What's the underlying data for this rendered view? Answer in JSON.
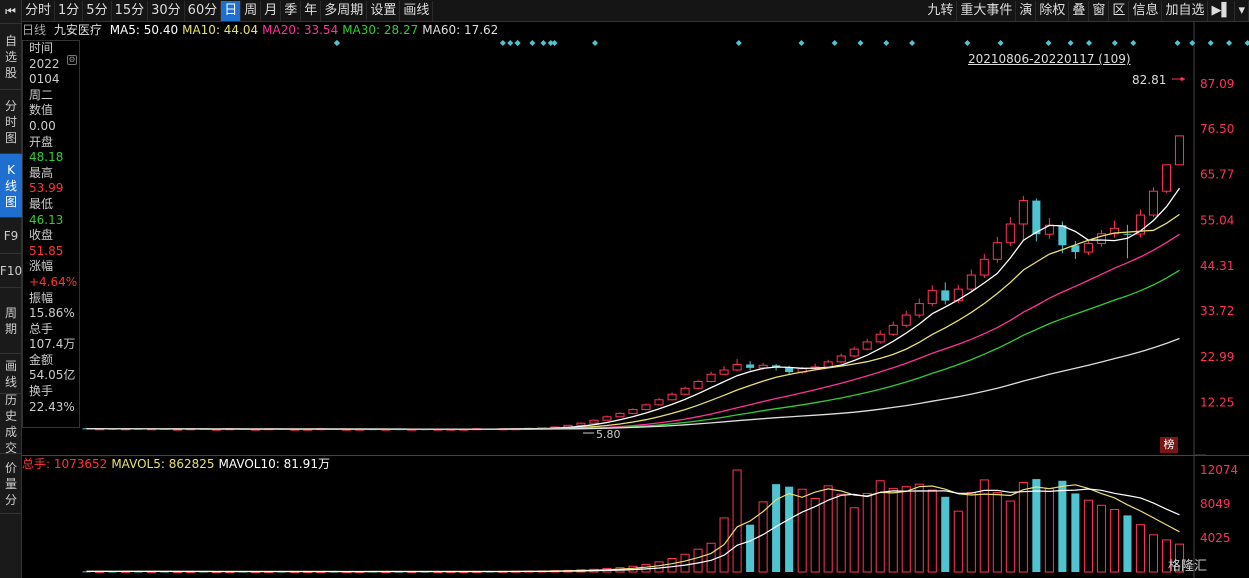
{
  "left_nav": {
    "home_icon": "first-page-icon",
    "items": [
      {
        "label": "自\n选\n股",
        "active": false
      },
      {
        "label": "分\n时\n图",
        "active": false
      },
      {
        "label": "K\n线\n图",
        "active": true
      },
      {
        "label": "F9",
        "active": false
      },
      {
        "label": "F10",
        "active": false
      },
      {
        "label": "周\n期",
        "active": false
      },
      {
        "label": "画\n线",
        "active": false
      },
      {
        "label": "历\n史\n成\n交",
        "active": false
      },
      {
        "label": "价\n量\n分",
        "active": false
      }
    ]
  },
  "toolbar": {
    "periods": [
      "分时",
      "1分",
      "5分",
      "15分",
      "30分",
      "60分",
      "日",
      "周",
      "月",
      "季",
      "年",
      "多周期",
      "设置",
      "画线"
    ],
    "active_period": "日",
    "right_items": [
      "九转",
      "重大事件",
      "演",
      "除权",
      "叠",
      "窗",
      "区",
      "信息",
      "加自选",
      "▶︎▌",
      "▾"
    ]
  },
  "ma_legend": {
    "period_label": "日线",
    "stock_name": "九安医疗",
    "items": [
      {
        "label": "MA5: 50.40",
        "color": "#ffffff"
      },
      {
        "label": "MA10: 44.04",
        "color": "#e8e070"
      },
      {
        "label": "MA20: 33.54",
        "color": "#ff3399"
      },
      {
        "label": "MA30: 28.27",
        "color": "#33cc33"
      },
      {
        "label": "MA60: 17.62",
        "color": "#dddddd"
      }
    ]
  },
  "info_panel": {
    "rows": [
      {
        "label": "时间",
        "value": "2022",
        "color": "#ccc"
      },
      {
        "label": "",
        "value": "0104",
        "color": "#ccc"
      },
      {
        "label": "",
        "value": "周二",
        "color": "#ccc"
      },
      {
        "label": "数值",
        "value": "0.00",
        "color": "#ccc"
      },
      {
        "label": "开盘",
        "value": "48.18",
        "color": "#33cc33"
      },
      {
        "label": "最高",
        "value": "53.99",
        "color": "#ff3333"
      },
      {
        "label": "最低",
        "value": "46.13",
        "color": "#33cc33"
      },
      {
        "label": "收盘",
        "value": "51.85",
        "color": "#ff3333"
      },
      {
        "label": "涨幅",
        "value": "+4.64%",
        "color": "#ff3333"
      },
      {
        "label": "振幅",
        "value": "15.86%",
        "color": "#ccc"
      },
      {
        "label": "总手",
        "value": "107.4万",
        "color": "#ccc"
      },
      {
        "label": "金额",
        "value": "54.05亿",
        "color": "#ccc"
      },
      {
        "label": "换手",
        "value": "22.43%",
        "color": "#ccc"
      }
    ]
  },
  "chart_annotations": {
    "range_label": "20210806-20220117 (109)",
    "last_price_label": "82.81",
    "min_price_label": "5.80",
    "badge": "榜"
  },
  "volume_legend": {
    "items": [
      {
        "label": "总手: 1073652",
        "color": "#ff3333"
      },
      {
        "label": "MAVOL5: 862825",
        "color": "#e8e070"
      },
      {
        "label": "MAVOL10: 81.91万",
        "color": "#ffffff"
      }
    ]
  },
  "watermark": "格隆汇",
  "colors": {
    "up": "#ff3355",
    "down": "#4fc3d0",
    "signal": "#4fc3d0"
  },
  "chart_data": {
    "type": "candlestick",
    "price_axis": {
      "ticks": [
        87.09,
        76.5,
        65.77,
        55.04,
        44.31,
        33.72,
        22.99,
        12.25
      ],
      "range": [
        5.8,
        87.09
      ]
    },
    "volume_axis": {
      "ticks": [
        12074,
        8049,
        4025
      ],
      "range": [
        0,
        12074
      ]
    },
    "candles": [
      [
        6.2,
        6.1,
        6.3,
        6.0
      ],
      [
        6.1,
        6.1,
        6.2,
        6.0
      ],
      [
        6.1,
        6.0,
        6.2,
        5.9
      ],
      [
        6.0,
        6.1,
        6.2,
        5.9
      ],
      [
        6.1,
        6.0,
        6.1,
        5.9
      ],
      [
        6.0,
        6.1,
        6.2,
        5.9
      ],
      [
        6.1,
        6.0,
        6.2,
        5.9
      ],
      [
        6.0,
        6.0,
        6.1,
        5.9
      ],
      [
        6.0,
        6.1,
        6.2,
        5.9
      ],
      [
        6.1,
        6.0,
        6.2,
        5.9
      ],
      [
        6.0,
        6.0,
        6.1,
        5.9
      ],
      [
        6.0,
        6.1,
        6.1,
        5.9
      ],
      [
        6.1,
        6.0,
        6.2,
        5.9
      ],
      [
        6.0,
        6.0,
        6.1,
        5.9
      ],
      [
        6.0,
        6.1,
        6.1,
        5.9
      ],
      [
        6.1,
        6.0,
        6.2,
        5.9
      ],
      [
        6.0,
        6.0,
        6.1,
        5.9
      ],
      [
        6.0,
        6.0,
        6.1,
        5.9
      ],
      [
        6.0,
        6.1,
        6.1,
        5.9
      ],
      [
        6.1,
        6.0,
        6.1,
        5.9
      ],
      [
        6.0,
        6.0,
        6.1,
        5.9
      ],
      [
        6.0,
        6.0,
        6.1,
        5.9
      ],
      [
        6.0,
        5.9,
        6.1,
        5.8
      ],
      [
        5.9,
        6.0,
        6.1,
        5.8
      ],
      [
        6.0,
        5.9,
        6.0,
        5.8
      ],
      [
        5.9,
        6.0,
        6.1,
        5.8
      ],
      [
        6.0,
        5.9,
        6.0,
        5.8
      ],
      [
        5.9,
        6.0,
        6.1,
        5.8
      ],
      [
        6.0,
        6.0,
        6.1,
        5.9
      ],
      [
        6.0,
        6.0,
        6.1,
        5.9
      ],
      [
        6.0,
        6.1,
        6.2,
        5.9
      ],
      [
        6.1,
        6.0,
        6.2,
        5.9
      ],
      [
        6.0,
        6.1,
        6.2,
        5.9
      ],
      [
        6.1,
        6.1,
        6.2,
        6.0
      ],
      [
        6.1,
        6.2,
        6.3,
        6.0
      ],
      [
        6.2,
        6.3,
        6.4,
        6.1
      ],
      [
        6.3,
        6.5,
        6.6,
        6.2
      ],
      [
        6.5,
        6.9,
        7.0,
        6.4
      ],
      [
        6.9,
        7.4,
        7.6,
        6.8
      ],
      [
        7.4,
        8.1,
        8.3,
        7.3
      ],
      [
        8.1,
        8.9,
        9.2,
        8.0
      ],
      [
        8.9,
        9.7,
        10.0,
        8.8
      ],
      [
        9.7,
        10.6,
        10.9,
        9.5
      ],
      [
        10.6,
        11.7,
        12.0,
        10.4
      ],
      [
        11.7,
        12.9,
        13.3,
        11.5
      ],
      [
        12.9,
        14.2,
        14.6,
        12.7
      ],
      [
        14.2,
        15.6,
        16.0,
        14.0
      ],
      [
        15.6,
        17.2,
        17.6,
        15.4
      ],
      [
        17.2,
        18.9,
        19.5,
        17.0
      ],
      [
        18.9,
        19.9,
        20.8,
        18.7
      ],
      [
        19.9,
        21.2,
        22.5,
        19.6
      ],
      [
        21.2,
        20.4,
        22.0,
        19.8
      ],
      [
        20.4,
        21.0,
        21.6,
        19.9
      ],
      [
        21.0,
        20.5,
        21.3,
        19.8
      ],
      [
        20.5,
        19.4,
        20.9,
        18.9
      ],
      [
        19.4,
        20.2,
        20.6,
        19.0
      ],
      [
        20.2,
        20.6,
        21.4,
        19.9
      ],
      [
        20.6,
        21.8,
        22.3,
        20.3
      ],
      [
        21.8,
        23.2,
        23.8,
        21.5
      ],
      [
        23.2,
        24.8,
        25.4,
        22.9
      ],
      [
        24.8,
        26.5,
        27.2,
        24.5
      ],
      [
        26.5,
        28.3,
        29.2,
        26.1
      ],
      [
        28.3,
        30.4,
        31.3,
        27.9
      ],
      [
        30.4,
        32.8,
        33.8,
        29.9
      ],
      [
        32.8,
        35.5,
        36.7,
        32.2
      ],
      [
        35.5,
        38.6,
        39.8,
        34.9
      ],
      [
        38.6,
        36.2,
        40.5,
        35.3
      ],
      [
        36.2,
        38.9,
        39.9,
        35.6
      ],
      [
        38.9,
        42.2,
        43.5,
        38.2
      ],
      [
        42.2,
        45.9,
        47.2,
        41.5
      ],
      [
        45.9,
        49.8,
        51.2,
        45.1
      ],
      [
        49.8,
        54.2,
        55.8,
        49.0
      ],
      [
        54.2,
        59.7,
        60.8,
        50.3
      ],
      [
        59.7,
        51.8,
        60.2,
        50.1
      ],
      [
        51.8,
        53.9,
        55.6,
        50.7
      ],
      [
        53.9,
        49.2,
        54.8,
        47.3
      ],
      [
        49.2,
        47.6,
        50.2,
        46.0
      ],
      [
        47.6,
        49.6,
        50.6,
        46.9
      ],
      [
        49.6,
        51.9,
        52.8,
        48.9
      ],
      [
        51.9,
        53.2,
        55.0,
        51.0
      ],
      [
        51.9,
        51.85,
        53.99,
        46.13
      ],
      [
        51.85,
        56.3,
        57.6,
        51.0
      ],
      [
        56.3,
        61.9,
        62.8,
        55.8
      ],
      [
        61.9,
        68.1,
        68.1,
        61.5
      ],
      [
        68.1,
        74.9,
        74.9,
        68.0
      ]
    ],
    "volume": [
      80,
      70,
      60,
      75,
      65,
      70,
      60,
      55,
      65,
      60,
      50,
      55,
      60,
      50,
      55,
      60,
      50,
      55,
      50,
      55,
      50,
      55,
      60,
      55,
      50,
      60,
      55,
      50,
      60,
      55,
      60,
      70,
      80,
      90,
      110,
      130,
      160,
      200,
      260,
      320,
      420,
      520,
      680,
      900,
      1200,
      1600,
      2100,
      2700,
      3400,
      6400,
      12074,
      5600,
      8300,
      10400,
      10100,
      9800,
      8700,
      10200,
      9200,
      7600,
      9300,
      10800,
      9900,
      10100,
      10400,
      9700,
      8900,
      7200,
      9400,
      10900,
      9400,
      8400,
      10600,
      11000,
      9900,
      10800,
      9300,
      8500,
      7900,
      7400,
      6700,
      5600,
      4400,
      3800,
      3300
    ],
    "signals_row1": [
      48,
      97,
      101,
      106,
      118,
      157,
      174,
      183,
      190,
      197,
      204,
      219,
      228,
      241,
      247,
      252,
      259,
      264,
      276,
      280,
      285,
      290,
      295
    ],
    "signals_row2": [
      48,
      93,
      95,
      97,
      104,
      107
    ]
  }
}
